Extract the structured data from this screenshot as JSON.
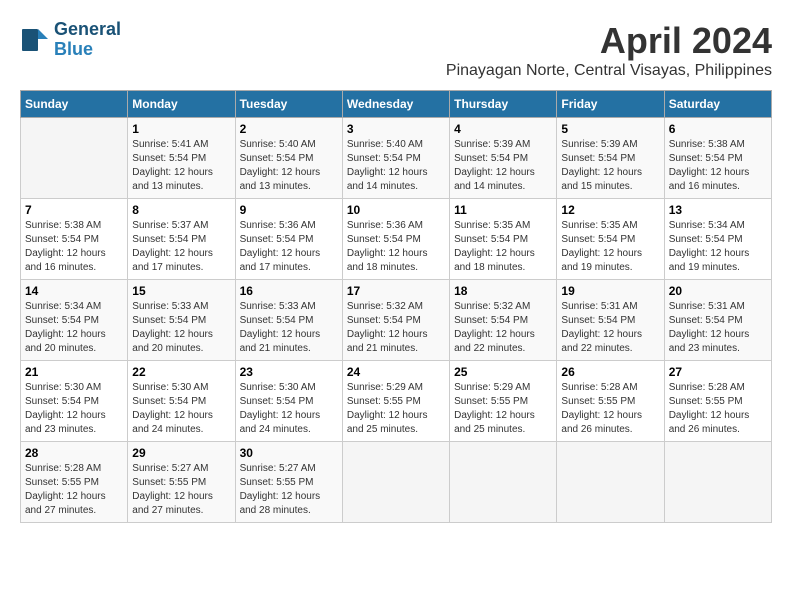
{
  "logo": {
    "line1": "General",
    "line2": "Blue"
  },
  "header": {
    "title": "April 2024",
    "location": "Pinayagan Norte, Central Visayas, Philippines"
  },
  "weekdays": [
    "Sunday",
    "Monday",
    "Tuesday",
    "Wednesday",
    "Thursday",
    "Friday",
    "Saturday"
  ],
  "weeks": [
    [
      {
        "day": "",
        "sunrise": "",
        "sunset": "",
        "daylight": ""
      },
      {
        "day": "1",
        "sunrise": "Sunrise: 5:41 AM",
        "sunset": "Sunset: 5:54 PM",
        "daylight": "Daylight: 12 hours and 13 minutes."
      },
      {
        "day": "2",
        "sunrise": "Sunrise: 5:40 AM",
        "sunset": "Sunset: 5:54 PM",
        "daylight": "Daylight: 12 hours and 13 minutes."
      },
      {
        "day": "3",
        "sunrise": "Sunrise: 5:40 AM",
        "sunset": "Sunset: 5:54 PM",
        "daylight": "Daylight: 12 hours and 14 minutes."
      },
      {
        "day": "4",
        "sunrise": "Sunrise: 5:39 AM",
        "sunset": "Sunset: 5:54 PM",
        "daylight": "Daylight: 12 hours and 14 minutes."
      },
      {
        "day": "5",
        "sunrise": "Sunrise: 5:39 AM",
        "sunset": "Sunset: 5:54 PM",
        "daylight": "Daylight: 12 hours and 15 minutes."
      },
      {
        "day": "6",
        "sunrise": "Sunrise: 5:38 AM",
        "sunset": "Sunset: 5:54 PM",
        "daylight": "Daylight: 12 hours and 16 minutes."
      }
    ],
    [
      {
        "day": "7",
        "sunrise": "Sunrise: 5:38 AM",
        "sunset": "Sunset: 5:54 PM",
        "daylight": "Daylight: 12 hours and 16 minutes."
      },
      {
        "day": "8",
        "sunrise": "Sunrise: 5:37 AM",
        "sunset": "Sunset: 5:54 PM",
        "daylight": "Daylight: 12 hours and 17 minutes."
      },
      {
        "day": "9",
        "sunrise": "Sunrise: 5:36 AM",
        "sunset": "Sunset: 5:54 PM",
        "daylight": "Daylight: 12 hours and 17 minutes."
      },
      {
        "day": "10",
        "sunrise": "Sunrise: 5:36 AM",
        "sunset": "Sunset: 5:54 PM",
        "daylight": "Daylight: 12 hours and 18 minutes."
      },
      {
        "day": "11",
        "sunrise": "Sunrise: 5:35 AM",
        "sunset": "Sunset: 5:54 PM",
        "daylight": "Daylight: 12 hours and 18 minutes."
      },
      {
        "day": "12",
        "sunrise": "Sunrise: 5:35 AM",
        "sunset": "Sunset: 5:54 PM",
        "daylight": "Daylight: 12 hours and 19 minutes."
      },
      {
        "day": "13",
        "sunrise": "Sunrise: 5:34 AM",
        "sunset": "Sunset: 5:54 PM",
        "daylight": "Daylight: 12 hours and 19 minutes."
      }
    ],
    [
      {
        "day": "14",
        "sunrise": "Sunrise: 5:34 AM",
        "sunset": "Sunset: 5:54 PM",
        "daylight": "Daylight: 12 hours and 20 minutes."
      },
      {
        "day": "15",
        "sunrise": "Sunrise: 5:33 AM",
        "sunset": "Sunset: 5:54 PM",
        "daylight": "Daylight: 12 hours and 20 minutes."
      },
      {
        "day": "16",
        "sunrise": "Sunrise: 5:33 AM",
        "sunset": "Sunset: 5:54 PM",
        "daylight": "Daylight: 12 hours and 21 minutes."
      },
      {
        "day": "17",
        "sunrise": "Sunrise: 5:32 AM",
        "sunset": "Sunset: 5:54 PM",
        "daylight": "Daylight: 12 hours and 21 minutes."
      },
      {
        "day": "18",
        "sunrise": "Sunrise: 5:32 AM",
        "sunset": "Sunset: 5:54 PM",
        "daylight": "Daylight: 12 hours and 22 minutes."
      },
      {
        "day": "19",
        "sunrise": "Sunrise: 5:31 AM",
        "sunset": "Sunset: 5:54 PM",
        "daylight": "Daylight: 12 hours and 22 minutes."
      },
      {
        "day": "20",
        "sunrise": "Sunrise: 5:31 AM",
        "sunset": "Sunset: 5:54 PM",
        "daylight": "Daylight: 12 hours and 23 minutes."
      }
    ],
    [
      {
        "day": "21",
        "sunrise": "Sunrise: 5:30 AM",
        "sunset": "Sunset: 5:54 PM",
        "daylight": "Daylight: 12 hours and 23 minutes."
      },
      {
        "day": "22",
        "sunrise": "Sunrise: 5:30 AM",
        "sunset": "Sunset: 5:54 PM",
        "daylight": "Daylight: 12 hours and 24 minutes."
      },
      {
        "day": "23",
        "sunrise": "Sunrise: 5:30 AM",
        "sunset": "Sunset: 5:54 PM",
        "daylight": "Daylight: 12 hours and 24 minutes."
      },
      {
        "day": "24",
        "sunrise": "Sunrise: 5:29 AM",
        "sunset": "Sunset: 5:55 PM",
        "daylight": "Daylight: 12 hours and 25 minutes."
      },
      {
        "day": "25",
        "sunrise": "Sunrise: 5:29 AM",
        "sunset": "Sunset: 5:55 PM",
        "daylight": "Daylight: 12 hours and 25 minutes."
      },
      {
        "day": "26",
        "sunrise": "Sunrise: 5:28 AM",
        "sunset": "Sunset: 5:55 PM",
        "daylight": "Daylight: 12 hours and 26 minutes."
      },
      {
        "day": "27",
        "sunrise": "Sunrise: 5:28 AM",
        "sunset": "Sunset: 5:55 PM",
        "daylight": "Daylight: 12 hours and 26 minutes."
      }
    ],
    [
      {
        "day": "28",
        "sunrise": "Sunrise: 5:28 AM",
        "sunset": "Sunset: 5:55 PM",
        "daylight": "Daylight: 12 hours and 27 minutes."
      },
      {
        "day": "29",
        "sunrise": "Sunrise: 5:27 AM",
        "sunset": "Sunset: 5:55 PM",
        "daylight": "Daylight: 12 hours and 27 minutes."
      },
      {
        "day": "30",
        "sunrise": "Sunrise: 5:27 AM",
        "sunset": "Sunset: 5:55 PM",
        "daylight": "Daylight: 12 hours and 28 minutes."
      },
      {
        "day": "",
        "sunrise": "",
        "sunset": "",
        "daylight": ""
      },
      {
        "day": "",
        "sunrise": "",
        "sunset": "",
        "daylight": ""
      },
      {
        "day": "",
        "sunrise": "",
        "sunset": "",
        "daylight": ""
      },
      {
        "day": "",
        "sunrise": "",
        "sunset": "",
        "daylight": ""
      }
    ]
  ]
}
